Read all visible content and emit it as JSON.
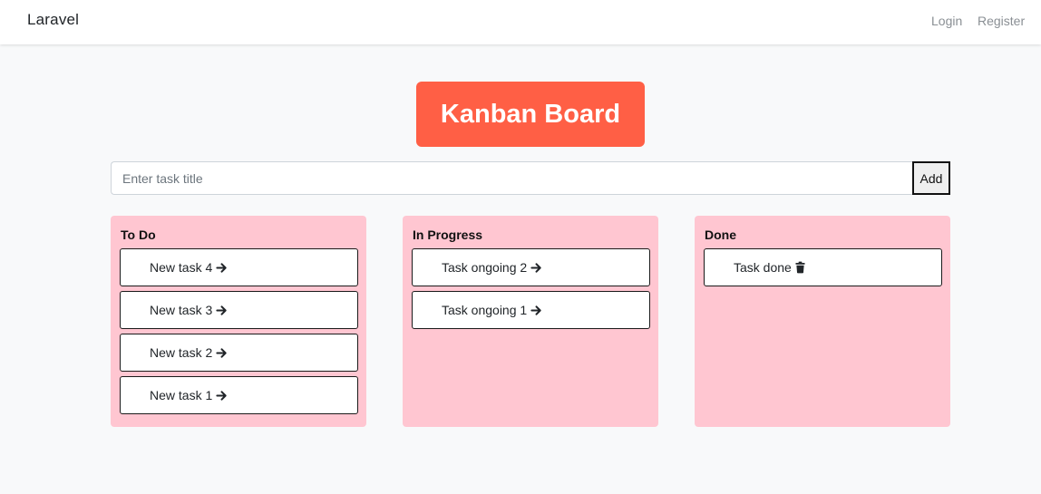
{
  "navbar": {
    "brand": "Laravel",
    "login": "Login",
    "register": "Register"
  },
  "title": "Kanban Board",
  "task_input": {
    "placeholder": "Enter task title",
    "value": ""
  },
  "add_button": "Add",
  "columns": [
    {
      "title": "To Do",
      "tasks": [
        {
          "title": "New task 4",
          "icon": "arrow-right-icon"
        },
        {
          "title": "New task 3",
          "icon": "arrow-right-icon"
        },
        {
          "title": "New task 2",
          "icon": "arrow-right-icon"
        },
        {
          "title": "New task 1",
          "icon": "arrow-right-icon"
        }
      ]
    },
    {
      "title": "In Progress",
      "tasks": [
        {
          "title": "Task ongoing 2",
          "icon": "arrow-right-icon"
        },
        {
          "title": "Task ongoing 1",
          "icon": "arrow-right-icon"
        }
      ]
    },
    {
      "title": "Done",
      "tasks": [
        {
          "title": "Task done",
          "icon": "trash-icon"
        }
      ]
    }
  ],
  "colors": {
    "title_bg": "#ff5f45",
    "column_bg": "#ffc6d1",
    "page_bg": "#f8f9fa"
  }
}
